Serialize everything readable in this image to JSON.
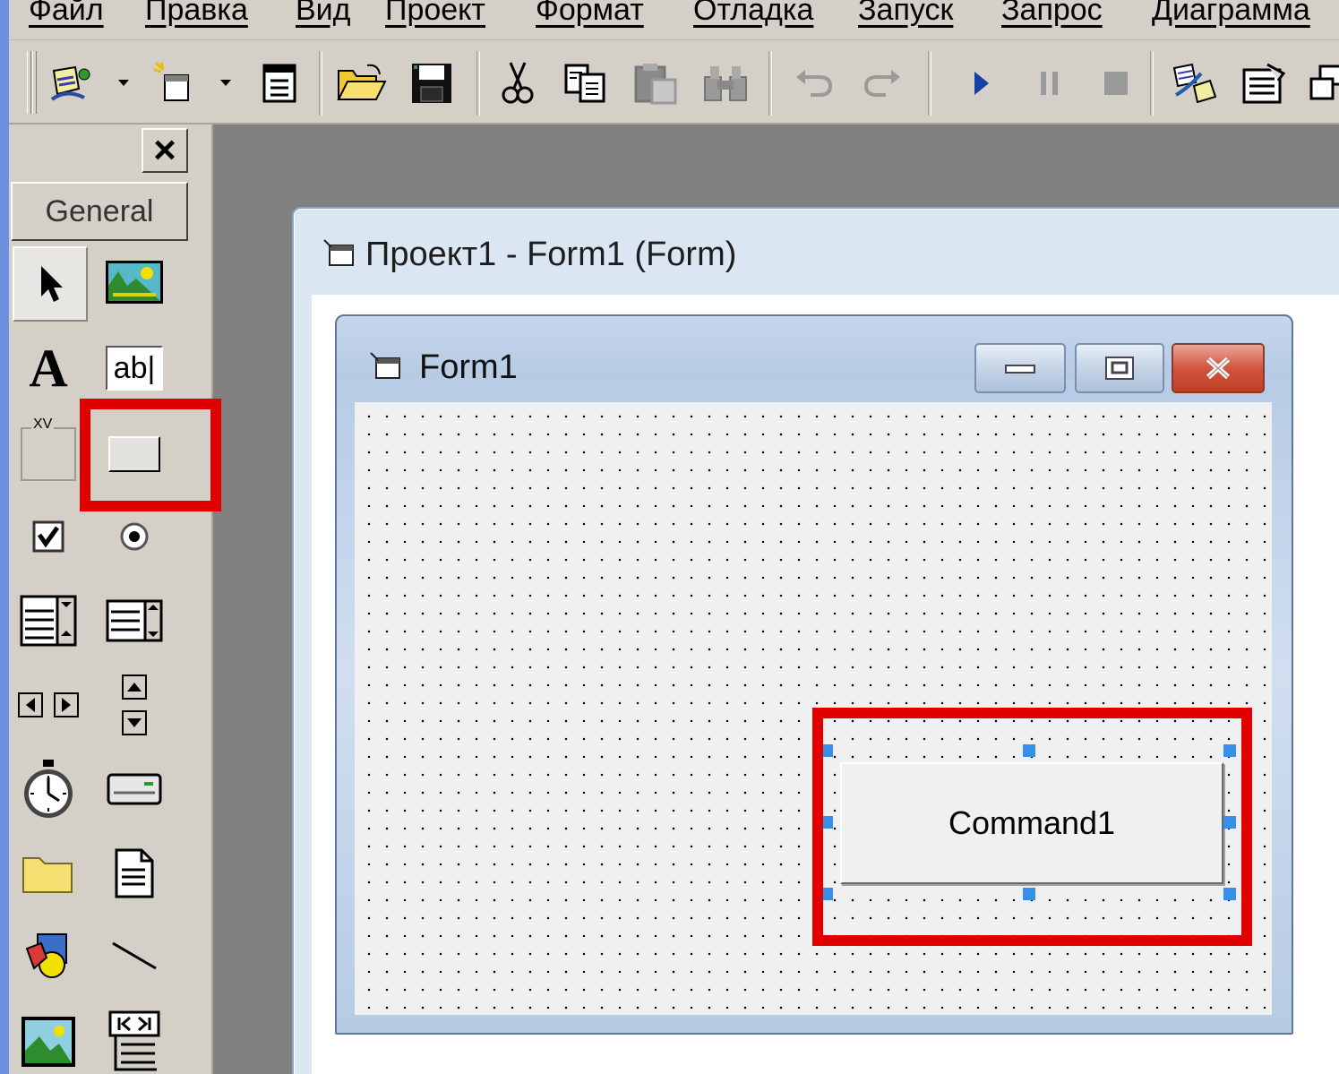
{
  "menu": {
    "items": [
      "Файл",
      "Правка",
      "Вид",
      "Проект",
      "Формат",
      "Отладка",
      "Запуск",
      "Запрос",
      "Диаграмма"
    ]
  },
  "toolbar": {
    "buttons": [
      "add-project-icon",
      "add-form-icon",
      "menu-editor-icon",
      "open-icon",
      "save-icon",
      "cut-icon",
      "copy-icon",
      "paste-icon",
      "find-icon",
      "undo-icon",
      "redo-icon",
      "start-icon",
      "break-icon",
      "end-icon",
      "project-explorer-icon",
      "properties-icon"
    ]
  },
  "toolbox": {
    "close_label": "×",
    "tab_label": "General",
    "frame_caption": "XV",
    "textbox_label": "ab|",
    "label_glyph": "A"
  },
  "designer": {
    "window_title": "Проект1 - Form1 (Form)"
  },
  "form": {
    "title": "Form1",
    "command_caption": "Command1"
  },
  "colors": {
    "highlight": "#e00000",
    "selection_handle": "#3a8ee8"
  }
}
